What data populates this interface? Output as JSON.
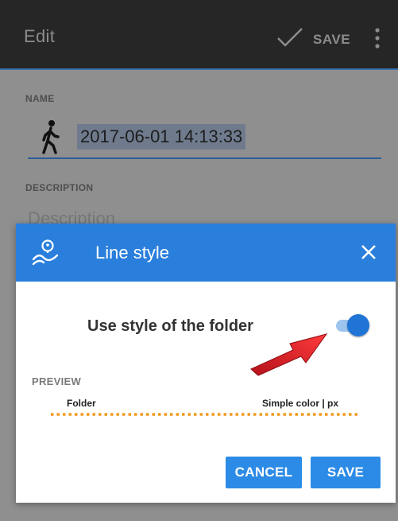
{
  "appbar": {
    "title": "Edit",
    "save_label": "SAVE",
    "icons": {
      "check": "check-icon",
      "more": "more-vert-icon"
    }
  },
  "form": {
    "name_label": "NAME",
    "name_value": "2017-06-01 14:13:33",
    "name_icon": "walking-person-icon",
    "description_label": "DESCRIPTION",
    "description_placeholder": "Description"
  },
  "dialog": {
    "title": "Line style",
    "header_icon": "route-icon",
    "close_icon": "close-icon",
    "toggle_label": "Use style of the folder",
    "toggle_on": true,
    "preview_label": "PREVIEW",
    "preview_left": "Folder",
    "preview_right": "Simple color | px",
    "preview_line_color": "#f39a1f",
    "cancel_label": "CANCEL",
    "save_label": "SAVE"
  },
  "colors": {
    "accent": "#2a7fdc",
    "appbar": "#262626",
    "annotation_arrow": "#e0262b"
  }
}
